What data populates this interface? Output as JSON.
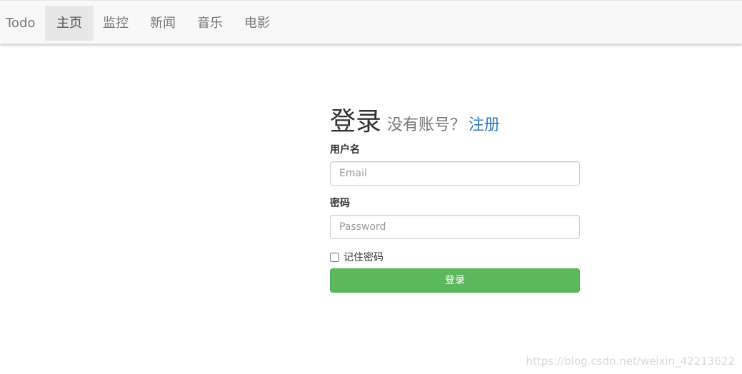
{
  "navbar": {
    "brand": "Todo",
    "items": [
      {
        "label": "主页",
        "active": true
      },
      {
        "label": "监控",
        "active": false
      },
      {
        "label": "新闻",
        "active": false
      },
      {
        "label": "音乐",
        "active": false
      },
      {
        "label": "电影",
        "active": false
      }
    ]
  },
  "login": {
    "title": "登录",
    "no_account": "没有账号？",
    "register_link": "注册",
    "username_label": "用户名",
    "username_placeholder": "Email",
    "username_value": "",
    "password_label": "密码",
    "password_placeholder": "Password",
    "password_value": "",
    "remember_label": "记住密码",
    "remember_checked": false,
    "submit_label": "登录"
  },
  "watermark": "https://blog.csdn.net/weixin_42213622",
  "colors": {
    "navbar_bg": "#f8f8f8",
    "nav_active_bg": "#e7e7e7",
    "link": "#337ab7",
    "success": "#5cb85c"
  }
}
